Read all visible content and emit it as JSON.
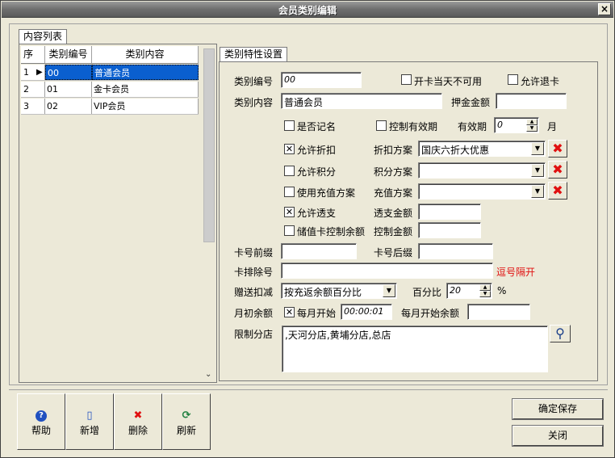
{
  "window": {
    "title": "会员类别编辑",
    "close": "×"
  },
  "left": {
    "tab": "内容列表",
    "columns": [
      "序",
      "类别编号",
      "类别内容"
    ],
    "rows": [
      {
        "seq": "1",
        "code": "00",
        "name": "普通会员"
      },
      {
        "seq": "2",
        "code": "01",
        "name": "金卡会员"
      },
      {
        "seq": "3",
        "code": "02",
        "name": "VIP会员"
      }
    ],
    "scroll_down": "⌄"
  },
  "form": {
    "tab": "类别特性设置",
    "code_label": "类别编号",
    "code_value": "00",
    "no_same_day_label": "开卡当天不可用",
    "allow_refund_label": "允许退卡",
    "content_label": "类别内容",
    "content_value": "普通会员",
    "deposit_label": "押金金额",
    "deposit_value": "",
    "named_label": "是否记名",
    "control_valid_label": "控制有效期",
    "valid_label": "有效期",
    "valid_value": "0",
    "valid_unit": "月",
    "allow_discount_label": "允许折扣",
    "allow_discount_mark": "✕",
    "discount_plan_label": "折扣方案",
    "discount_plan_value": "国庆六折大优惠",
    "allow_points_label": "允许积分",
    "points_plan_label": "积分方案",
    "points_plan_value": "",
    "use_recharge_label": "使用充值方案",
    "recharge_plan_label": "充值方案",
    "recharge_plan_value": "",
    "allow_overdraft_label": "允许透支",
    "allow_overdraft_mark": "✕",
    "overdraft_amount_label": "透支金额",
    "overdraft_amount_value": "",
    "stored_control_label": "储值卡控制余额",
    "control_amount_label": "控制金额",
    "control_amount_value": "",
    "prefix_label": "卡号前缀",
    "prefix_value": "",
    "suffix_label": "卡号后缀",
    "suffix_value": "",
    "exclude_label": "卡排除号",
    "exclude_value": "",
    "exclude_hint": "逗号隔开",
    "gift_label": "赠送扣减",
    "gift_value": "按充返余额百分比",
    "percent_label": "百分比",
    "percent_value": "20",
    "percent_unit": "%",
    "monthly_label": "月初余额",
    "monthly_start_label": "每月开始",
    "monthly_start_mark": "✕",
    "monthly_time_value": "00:00:01",
    "monthly_balance_label": "每月开始余额",
    "monthly_balance_value": "",
    "branch_label": "限制分店",
    "branch_value": ",天河分店,黄埔分店,总店",
    "x_mark": "✖",
    "combo_arrow": "▼",
    "spin_up": "▲",
    "spin_down": "▼",
    "search_glyph": "⚲"
  },
  "toolbar": {
    "help": {
      "label": "帮助",
      "glyph": "?"
    },
    "add": {
      "label": "新增",
      "glyph": "▯"
    },
    "delete": {
      "label": "删除",
      "glyph": "✖"
    },
    "refresh": {
      "label": "刷新",
      "glyph": "⟳"
    }
  },
  "actions": {
    "save": "确定保存",
    "close": "关闭"
  },
  "colors": {
    "selection": "#0a5fcf",
    "danger": "#e01010",
    "help": "#2050c0",
    "refresh": "#208040"
  }
}
